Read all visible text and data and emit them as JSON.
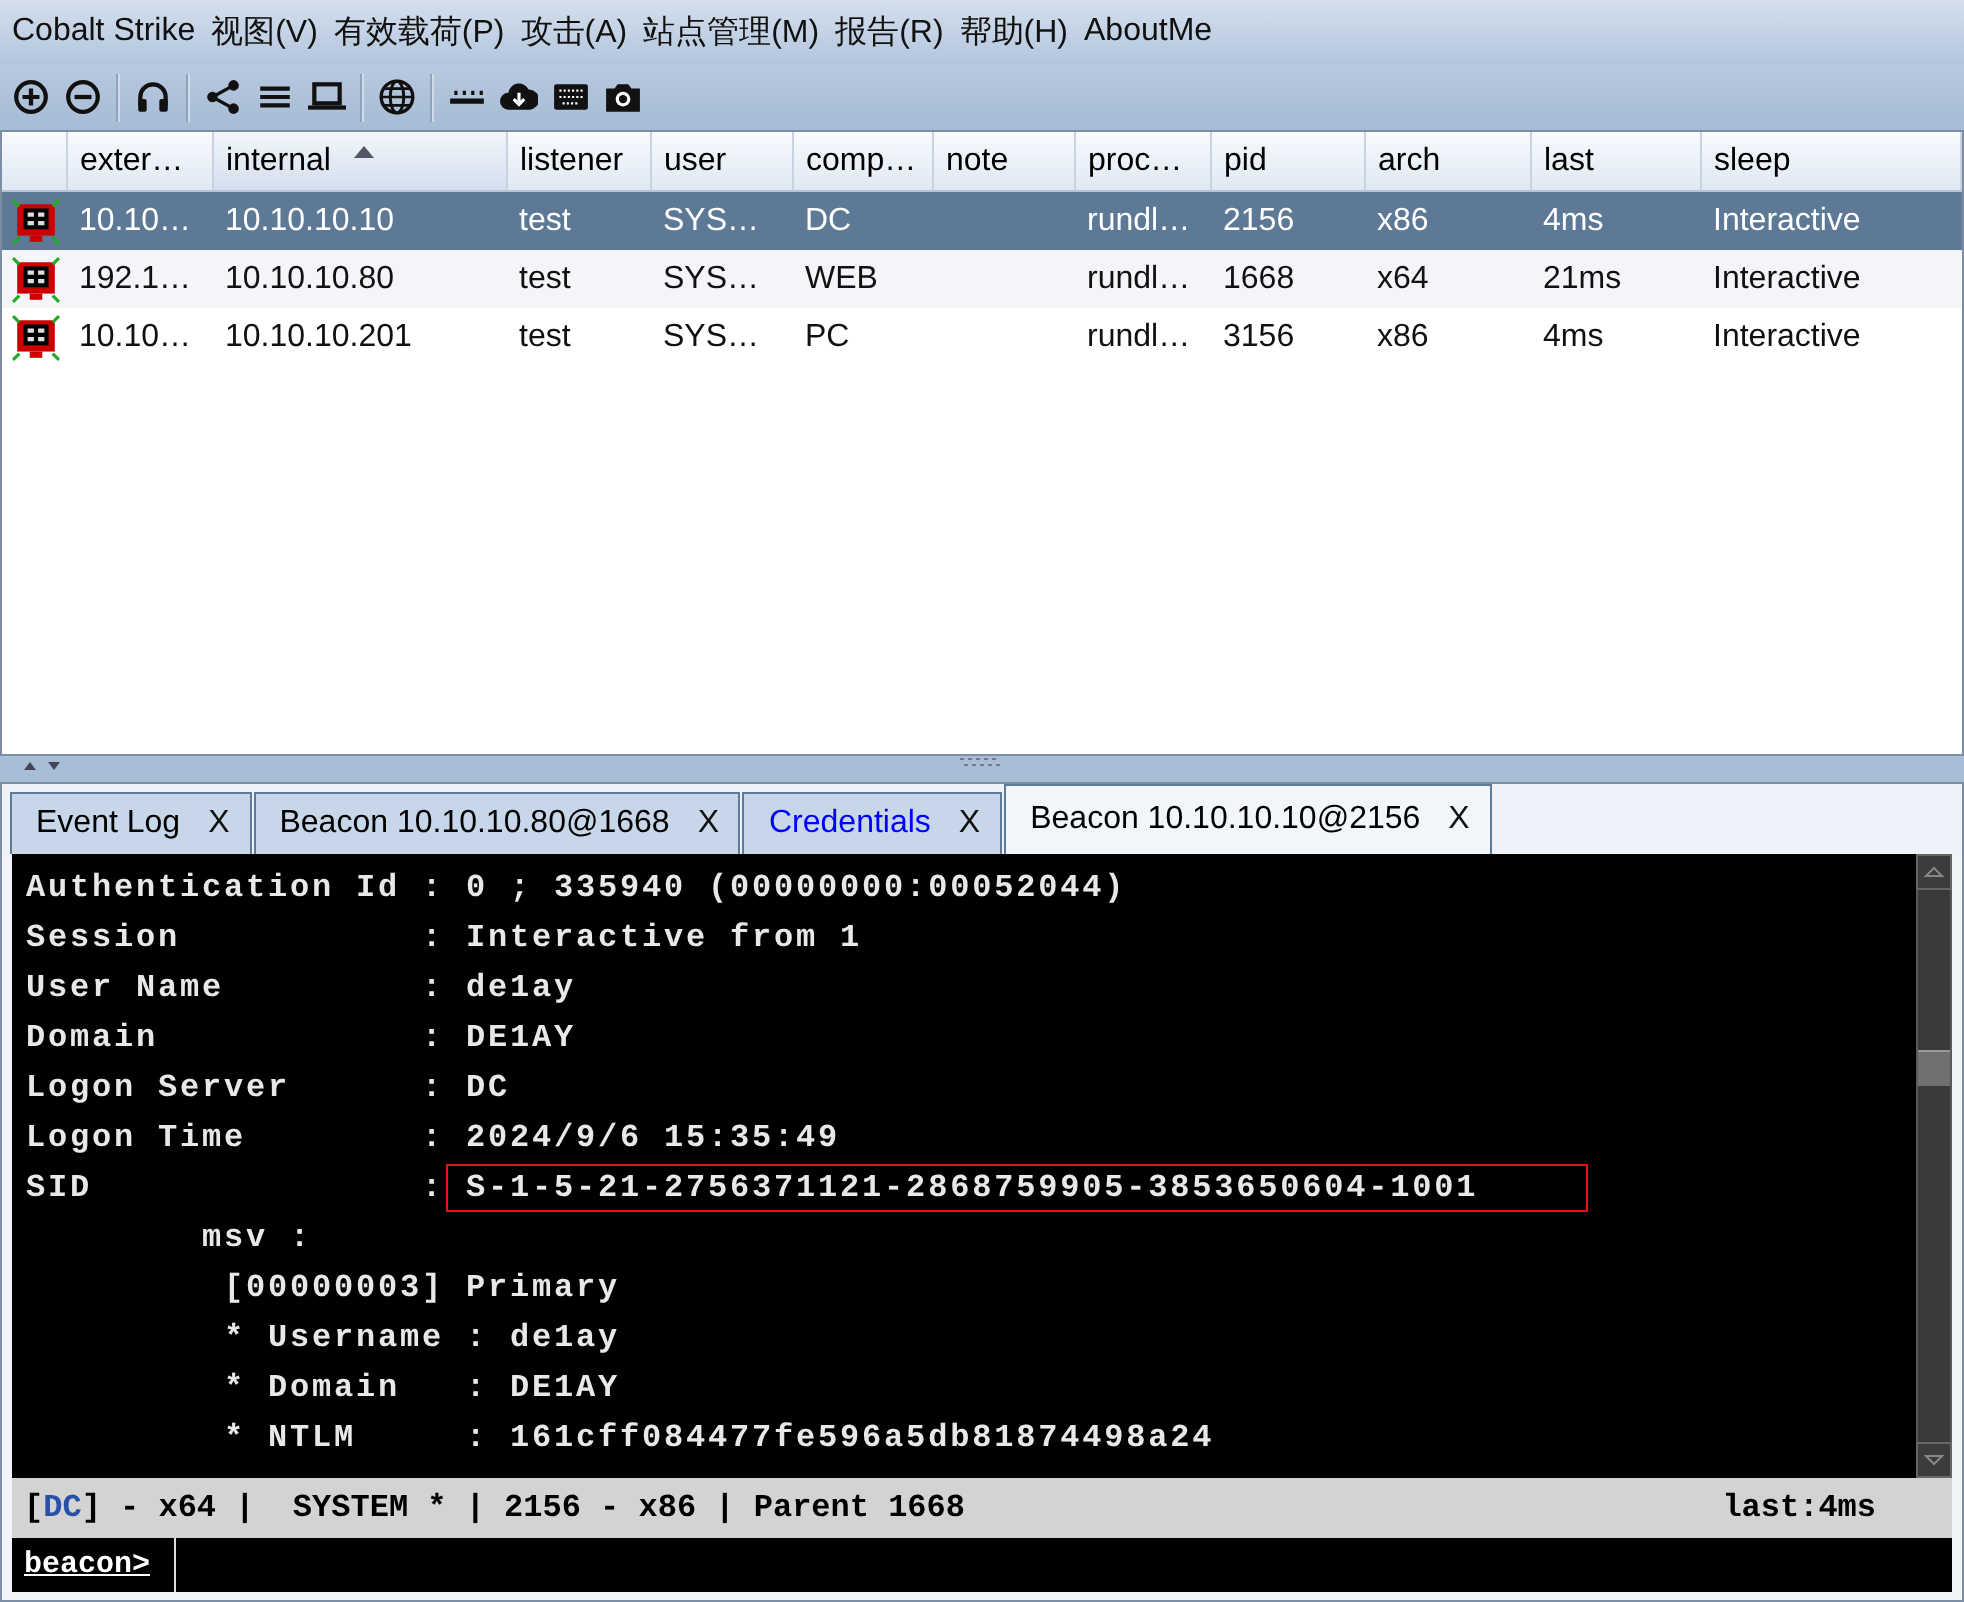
{
  "menu_bar": [
    "Cobalt Strike",
    "视图(V)",
    "有效载荷(P)",
    "攻击(A)",
    "站点管理(M)",
    "报告(R)",
    "帮助(H)",
    "AboutMe"
  ],
  "table": {
    "columns": [
      {
        "label": "exter…",
        "sorted": false
      },
      {
        "label": "internal",
        "sorted": true
      },
      {
        "label": "listener",
        "sorted": false
      },
      {
        "label": "user",
        "sorted": false
      },
      {
        "label": "comp…",
        "sorted": false
      },
      {
        "label": "note",
        "sorted": false
      },
      {
        "label": "proc…",
        "sorted": false
      },
      {
        "label": "pid",
        "sorted": false
      },
      {
        "label": "arch",
        "sorted": false
      },
      {
        "label": "last",
        "sorted": false
      },
      {
        "label": "sleep",
        "sorted": false
      }
    ],
    "rows": [
      {
        "selected": true,
        "cells": [
          "10.10…",
          "10.10.10.10",
          "test",
          "SYS…",
          "DC",
          "",
          "rundl…",
          "2156",
          "x86",
          "4ms",
          "Interactive"
        ]
      },
      {
        "selected": false,
        "cells": [
          "192.1…",
          "10.10.10.80",
          "test",
          "SYS…",
          "WEB",
          "",
          "rundl…",
          "1668",
          "x64",
          "21ms",
          "Interactive"
        ]
      },
      {
        "selected": false,
        "cells": [
          "10.10…",
          "10.10.10.201",
          "test",
          "SYS…",
          "PC",
          "",
          "rundl…",
          "3156",
          "x86",
          "4ms",
          "Interactive"
        ]
      }
    ]
  },
  "tabs": [
    {
      "label": "Event Log",
      "close": "X",
      "selected": false,
      "color": "#000000"
    },
    {
      "label": "Beacon 10.10.10.80@1668",
      "close": "X",
      "selected": false,
      "color": "#000000"
    },
    {
      "label": "Credentials",
      "close": "X",
      "selected": false,
      "color": "#0000ff"
    },
    {
      "label": "Beacon 10.10.10.10@2156",
      "close": "X",
      "selected": true,
      "color": "#000000"
    }
  ],
  "console": {
    "lines": [
      {
        "text": "Authentication Id : 0 ; 335940 (00000000:00052044)"
      },
      {
        "text": "Session           : Interactive from 1"
      },
      {
        "text": "User Name         : de1ay"
      },
      {
        "text": "Domain            : DE1AY"
      },
      {
        "text": "Logon Server      : DC"
      },
      {
        "text": "Logon Time        : 2024/9/6 15:35:49"
      },
      {
        "text": "SID               :",
        "boxed": "S-1-5-21-2756371121-2868759905-3853650604-1001"
      },
      {
        "text": "        msv :"
      },
      {
        "text": "         [00000003] Primary"
      },
      {
        "text": "         * Username : de1ay"
      },
      {
        "text": "         * Domain   : DE1AY"
      },
      {
        "text": "         * NTLM     : 161cff084477fe596a5db81874498a24"
      }
    ],
    "status_bar": {
      "segments": [
        {
          "text": "[",
          "color": "#000000"
        },
        {
          "text": "DC",
          "color": "#2850a8"
        },
        {
          "text": "] - x64 |  SYSTEM * | 2156 - x86 | Parent 1668",
          "color": "#000000"
        }
      ],
      "last": "last:4ms"
    },
    "prompt": "beacon>"
  }
}
